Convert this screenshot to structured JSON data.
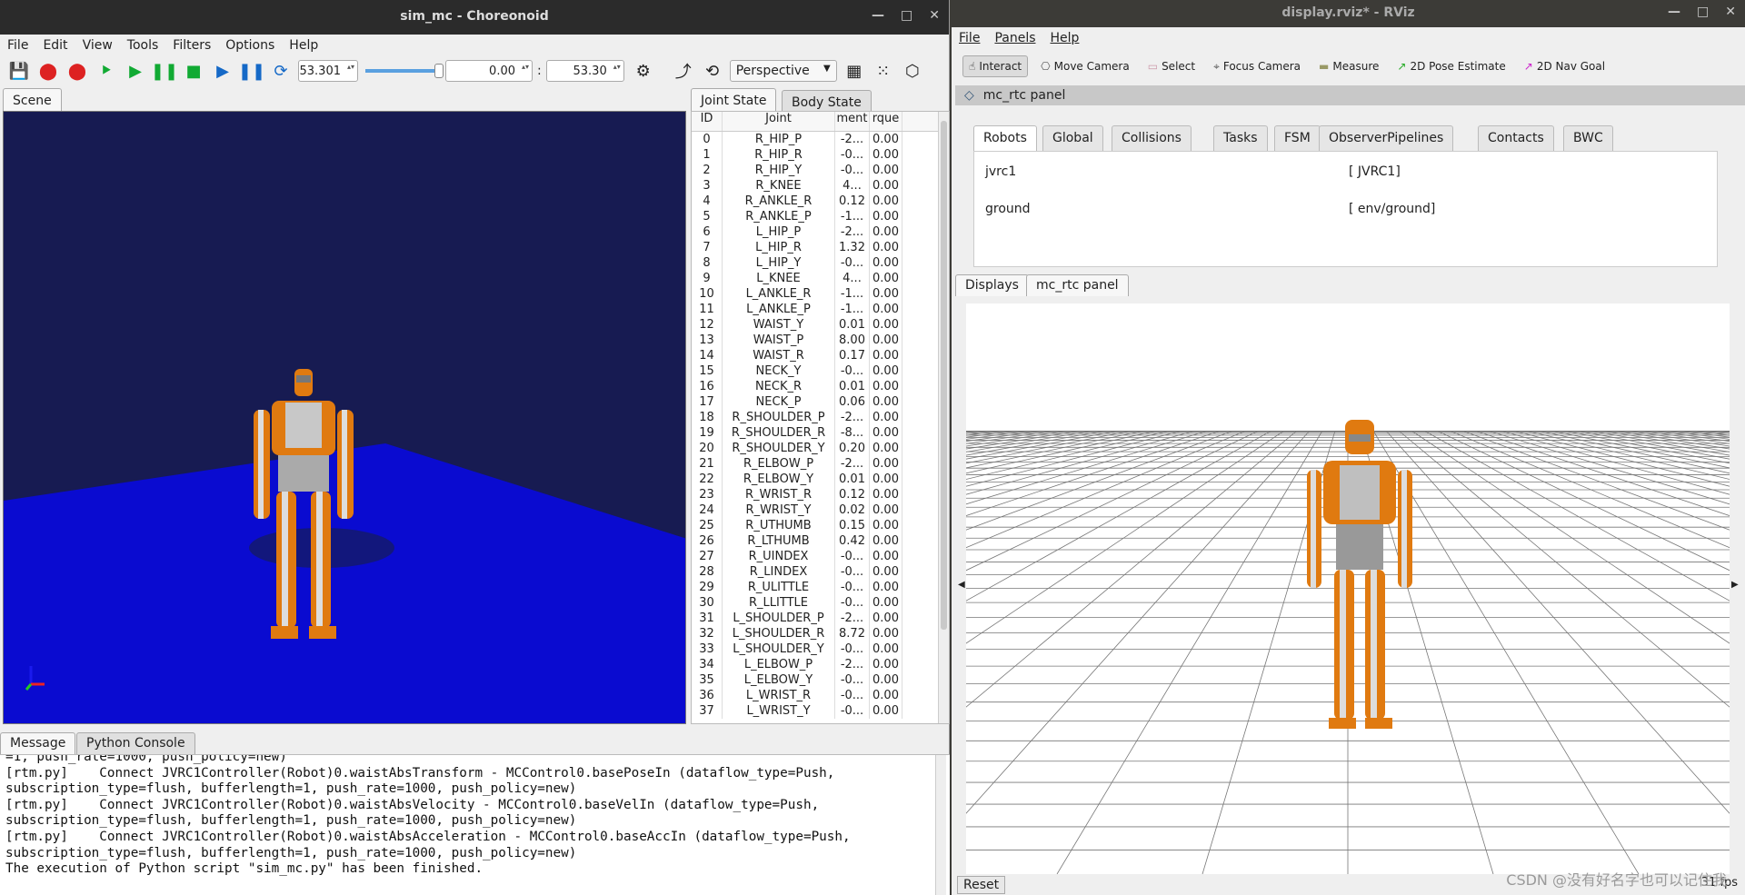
{
  "choreonoid": {
    "title": "sim_mc - Choreonoid",
    "menu": [
      "File",
      "Edit",
      "View",
      "Tools",
      "Filters",
      "Options",
      "Help"
    ],
    "time_value": "53.301",
    "range_start": "0.00",
    "range_sep": ":",
    "range_end": "53.30",
    "camera_mode": "Perspective",
    "scene_tab": "Scene",
    "joint_tab": "Joint State",
    "body_tab": "Body State",
    "joint_headers": [
      "ID",
      "Joint",
      "ment",
      "rque"
    ],
    "joints": [
      [
        "0",
        "R_HIP_P",
        "-2...",
        "0.00"
      ],
      [
        "1",
        "R_HIP_R",
        "-0...",
        "0.00"
      ],
      [
        "2",
        "R_HIP_Y",
        "-0...",
        "0.00"
      ],
      [
        "3",
        "R_KNEE",
        "4...",
        "0.00"
      ],
      [
        "4",
        "R_ANKLE_R",
        "0.12",
        "0.00"
      ],
      [
        "5",
        "R_ANKLE_P",
        "-1...",
        "0.00"
      ],
      [
        "6",
        "L_HIP_P",
        "-2...",
        "0.00"
      ],
      [
        "7",
        "L_HIP_R",
        "1.32",
        "0.00"
      ],
      [
        "8",
        "L_HIP_Y",
        "-0...",
        "0.00"
      ],
      [
        "9",
        "L_KNEE",
        "4...",
        "0.00"
      ],
      [
        "10",
        "L_ANKLE_R",
        "-1...",
        "0.00"
      ],
      [
        "11",
        "L_ANKLE_P",
        "-1...",
        "0.00"
      ],
      [
        "12",
        "WAIST_Y",
        "0.01",
        "0.00"
      ],
      [
        "13",
        "WAIST_P",
        "8.00",
        "0.00"
      ],
      [
        "14",
        "WAIST_R",
        "0.17",
        "0.00"
      ],
      [
        "15",
        "NECK_Y",
        "-0...",
        "0.00"
      ],
      [
        "16",
        "NECK_R",
        "0.01",
        "0.00"
      ],
      [
        "17",
        "NECK_P",
        "0.06",
        "0.00"
      ],
      [
        "18",
        "R_SHOULDER_P",
        "-2...",
        "0.00"
      ],
      [
        "19",
        "R_SHOULDER_R",
        "-8...",
        "0.00"
      ],
      [
        "20",
        "R_SHOULDER_Y",
        "0.20",
        "0.00"
      ],
      [
        "21",
        "R_ELBOW_P",
        "-2...",
        "0.00"
      ],
      [
        "22",
        "R_ELBOW_Y",
        "0.01",
        "0.00"
      ],
      [
        "23",
        "R_WRIST_R",
        "0.12",
        "0.00"
      ],
      [
        "24",
        "R_WRIST_Y",
        "0.02",
        "0.00"
      ],
      [
        "25",
        "R_UTHUMB",
        "0.15",
        "0.00"
      ],
      [
        "26",
        "R_LTHUMB",
        "0.42",
        "0.00"
      ],
      [
        "27",
        "R_UINDEX",
        "-0...",
        "0.00"
      ],
      [
        "28",
        "R_LINDEX",
        "-0...",
        "0.00"
      ],
      [
        "29",
        "R_ULITTLE",
        "-0...",
        "0.00"
      ],
      [
        "30",
        "R_LLITTLE",
        "-0...",
        "0.00"
      ],
      [
        "31",
        "L_SHOULDER_P",
        "-2...",
        "0.00"
      ],
      [
        "32",
        "L_SHOULDER_R",
        "8.72",
        "0.00"
      ],
      [
        "33",
        "L_SHOULDER_Y",
        "-0...",
        "0.00"
      ],
      [
        "34",
        "L_ELBOW_P",
        "-2...",
        "0.00"
      ],
      [
        "35",
        "L_ELBOW_Y",
        "-0...",
        "0.00"
      ],
      [
        "36",
        "L_WRIST_R",
        "-0...",
        "0.00"
      ],
      [
        "37",
        "L_WRIST_Y",
        "-0...",
        "0.00"
      ]
    ],
    "message_tab": "Message",
    "python_tab": "Python Console",
    "messages": "=1, push_rate=1000, push_policy=new)\n[rtm.py]    Connect JVRC1Controller(Robot)0.waistAbsTransform - MCControl0.basePoseIn (dataflow_type=Push, subscription_type=flush, bufferlength=1, push_rate=1000, push_policy=new)\n[rtm.py]    Connect JVRC1Controller(Robot)0.waistAbsVelocity - MCControl0.baseVelIn (dataflow_type=Push, subscription_type=flush, bufferlength=1, push_rate=1000, push_policy=new)\n[rtm.py]    Connect JVRC1Controller(Robot)0.waistAbsAcceleration - MCControl0.baseAccIn (dataflow_type=Push, subscription_type=flush, bufferlength=1, push_rate=1000, push_policy=new)\nThe execution of Python script \"sim_mc.py\" has been finished."
  },
  "rviz": {
    "title": "display.rviz* - RViz",
    "menu": [
      "File",
      "Panels",
      "Help"
    ],
    "tools": [
      "Interact",
      "Move Camera",
      "Select",
      "Focus Camera",
      "Measure",
      "2D Pose Estimate",
      "2D Nav Goal"
    ],
    "panel_title": "mc_rtc panel",
    "tabs": [
      "Robots",
      "Global",
      "Collisions",
      "Tasks",
      "FSM",
      "ObserverPipelines",
      "Contacts",
      "BWC"
    ],
    "robots": [
      {
        "name": "jvrc1",
        "value": "[ JVRC1]"
      },
      {
        "name": "ground",
        "value": "[ env/ground]"
      }
    ],
    "bottom_tabs": [
      "Displays",
      "mc_rtc panel"
    ],
    "reset": "Reset",
    "fps": "31 fps",
    "watermark": "CSDN @没有好名字也可以记住我"
  }
}
